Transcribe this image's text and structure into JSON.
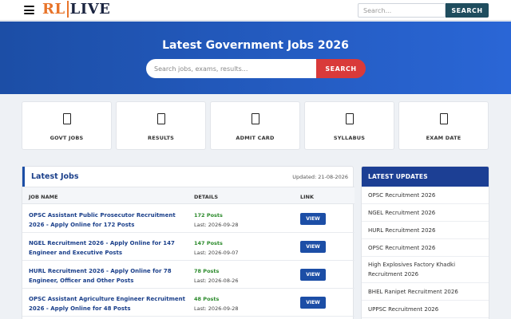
{
  "header": {
    "logo_left": "RL",
    "logo_right": "LIVE",
    "search_placeholder": "Search...",
    "search_button": "SEARCH"
  },
  "hero": {
    "title": "Latest Government Jobs 2026",
    "search_placeholder": "Search jobs, exams, results...",
    "search_button": "SEARCH"
  },
  "categories": [
    {
      "label": "GOVT JOBS",
      "icon": "document-icon"
    },
    {
      "label": "RESULTS",
      "icon": "document-icon"
    },
    {
      "label": "ADMIT CARD",
      "icon": "document-icon"
    },
    {
      "label": "SYLLABUS",
      "icon": "document-icon"
    },
    {
      "label": "EXAM DATE",
      "icon": "document-icon"
    }
  ],
  "jobs": {
    "title": "Latest Jobs",
    "updated": "Updated: 21-08-2026",
    "columns": {
      "job": "JOB NAME",
      "details": "DETAILS",
      "link": "LINK"
    },
    "rows": [
      {
        "name": "OPSC Assistant Public Prosecutor Recruitment 2026 - Apply Online for 172 Posts",
        "posts": "172 Posts",
        "last": "Last: 2026-09-28",
        "button": "VIEW"
      },
      {
        "name": "NGEL Recruitment 2026 - Apply Online for 147 Engineer and Executive Posts",
        "posts": "147 Posts",
        "last": "Last: 2026-09-07",
        "button": "VIEW"
      },
      {
        "name": "HURL Recruitment 2026 - Apply Online for 78 Engineer, Officer and Other Posts",
        "posts": "78 Posts",
        "last": "Last: 2026-08-26",
        "button": "VIEW"
      },
      {
        "name": "OPSC Assistant Agriculture Engineer Recruitment 2026 - Apply Online for 48 Posts",
        "posts": "48 Posts",
        "last": "Last: 2026-09-28",
        "button": "VIEW"
      }
    ]
  },
  "updates": {
    "title": "LATEST UPDATES",
    "items": [
      "OPSC Recruitment 2026",
      "NGEL Recruitment 2026",
      "HURL Recruitment 2026",
      "OPSC Recruitment 2026",
      "High Explosives Factory Khadki Recruitment 2026",
      "BHEL Ranipet Recruitment 2026",
      "UPPSC Recruitment 2026"
    ]
  },
  "colors": {
    "brand_blue": "#1c4ea6",
    "accent_orange": "#e8742a",
    "hero_button_red": "#d93a3a",
    "posts_green": "#2b8a2b"
  }
}
